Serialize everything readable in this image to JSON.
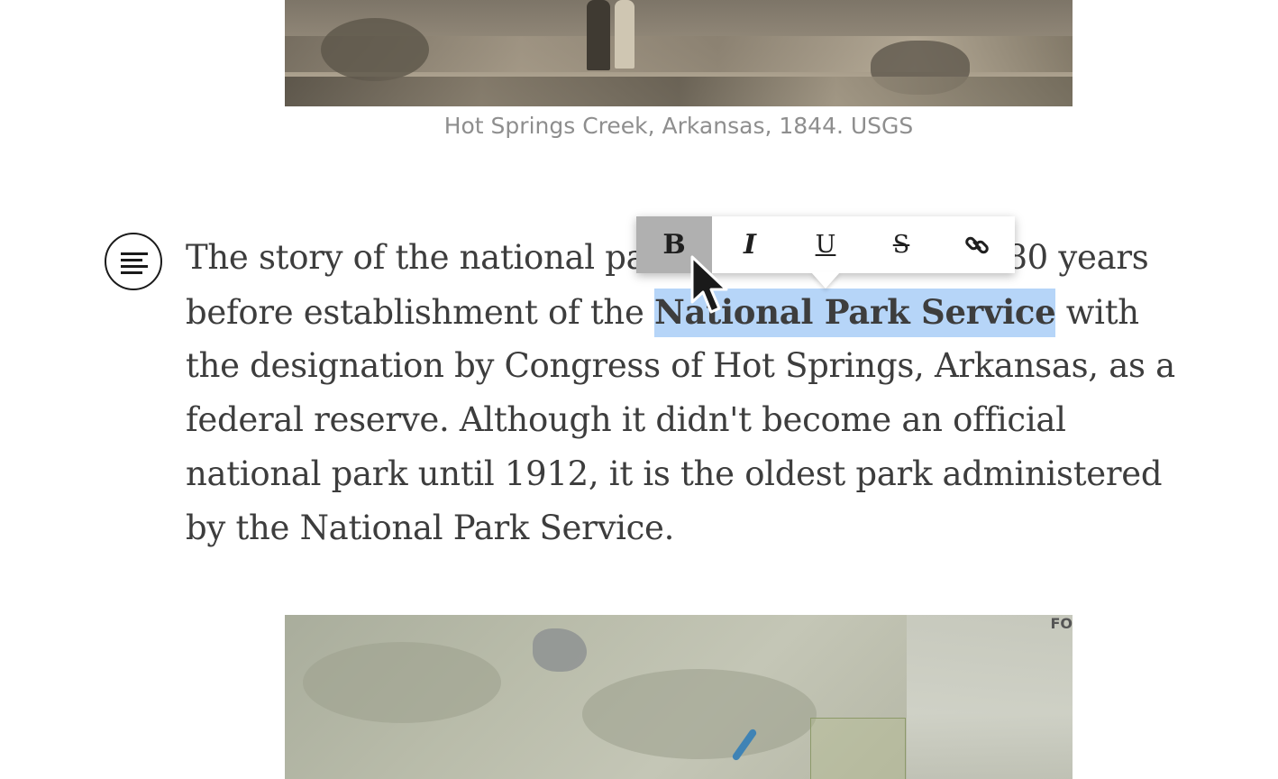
{
  "figure_top": {
    "image_name": "hot-springs-engraving",
    "caption": "Hot Springs Creek, Arkansas, 1844. USGS"
  },
  "block_icon": "paragraph-align-icon",
  "paragraph": {
    "line1_before": "The story of the national pa",
    "line1_after": "80 years",
    "line2_before": "before establishment of the ",
    "line2_selected": "National Park Service",
    "line2_after": " with",
    "line3": "the designation by Congress of Hot Springs, Arkansas, as a",
    "line4": "federal reserve. Although it didn't become an official",
    "line5": "national park until 1912, it is the oldest park administered",
    "line6": "by the National Park Service."
  },
  "toolbar": {
    "bold_label": "B",
    "italic_label": "I",
    "underline_label": "U",
    "strike_label": "S",
    "link_icon": "link-icon",
    "active": "bold"
  },
  "figure_bottom": {
    "image_name": "hot-springs-map",
    "map_label": "FO"
  },
  "colors": {
    "selection": "#b6d5f8",
    "toolbar_active": "#b0b0b0",
    "caption": "#8e8e8e",
    "text": "#3d3d3d"
  }
}
